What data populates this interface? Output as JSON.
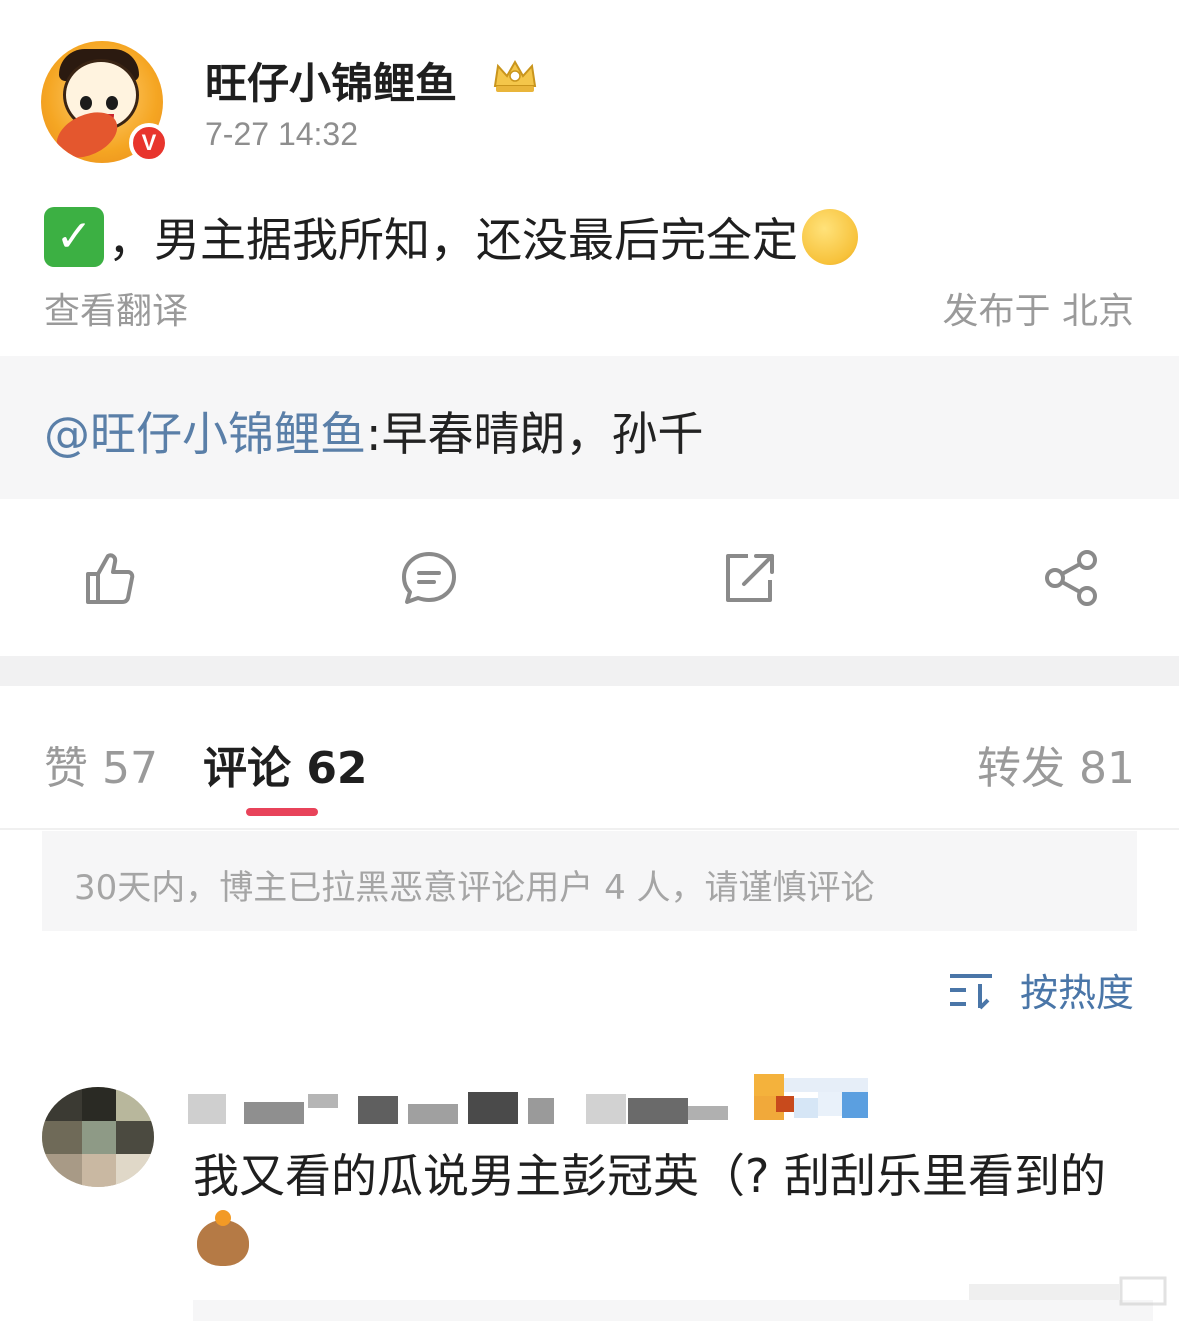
{
  "header": {
    "username": "旺仔小锦鲤鱼",
    "timestamp": "7-27 14:32",
    "verified_badge": "V",
    "icons": [
      "crown-badge-icon",
      "verified-icon"
    ]
  },
  "post": {
    "text": "，男主据我所知，还没最后完全定",
    "translate_label": "查看翻译",
    "location_label": "发布于 北京"
  },
  "repost": {
    "mention": "@旺仔小锦鲤鱼",
    "text": ":早春晴朗，孙千"
  },
  "actions": {
    "icons": [
      "like-icon",
      "comment-icon",
      "repost-icon",
      "share-icon"
    ]
  },
  "tabs": {
    "likes": "赞 57",
    "comments": "评论 62",
    "reposts": "转发 81"
  },
  "notice": {
    "text": "30天内，博主已拉黑恶意评论用户 4 人，请谨慎评论"
  },
  "sort": {
    "label": "按热度"
  },
  "comment": {
    "text": "我又看的瓜说男主彭冠英（? 刮刮乐里看到的"
  },
  "colors": {
    "accent_tab": "#e8435a",
    "link_blue": "#5a7fa8",
    "sort_blue": "#4a76a8",
    "verified_red": "#e8352d"
  }
}
